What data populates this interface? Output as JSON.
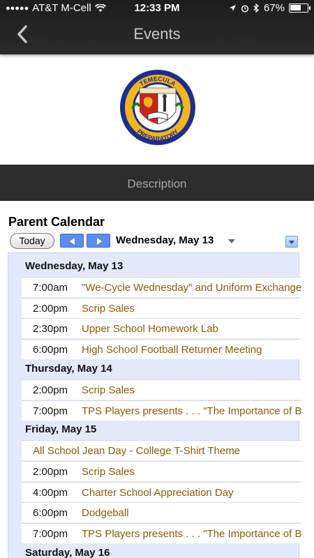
{
  "status_bar": {
    "carrier": "AT&T M-Cell",
    "time": "12:33 PM",
    "battery": "67%",
    "battery_level": 0.67
  },
  "header": {
    "title": "Events",
    "back_icon": "chevron-left-icon"
  },
  "logo": {
    "top_text": "TEMECULA",
    "bottom_text": "PREPARATORY",
    "motto": "DOCERE DISCIPLINA VIRTUS"
  },
  "description_bar": {
    "label": "Description"
  },
  "calendar": {
    "title": "Parent Calendar",
    "today_label": "Today",
    "current_date": "Wednesday, May 13",
    "days": [
      {
        "label": "Wednesday, May 13",
        "events": [
          {
            "time": "7:00am",
            "title": "\"We-Cycle Wednesday\" and Uniform Exchange"
          },
          {
            "time": "2:00pm",
            "title": "Scrip Sales"
          },
          {
            "time": "2:30pm",
            "title": "Upper School Homework Lab"
          },
          {
            "time": "6:00pm",
            "title": "High School Football Returner Meeting"
          }
        ]
      },
      {
        "label": "Thursday, May 14",
        "events": [
          {
            "time": "2:00pm",
            "title": "Scrip Sales"
          },
          {
            "time": "7:00pm",
            "title": "TPS Players presents . . . \"The Importance of Being Earnest\""
          }
        ]
      },
      {
        "label": "Friday, May 15",
        "events": [
          {
            "time": "",
            "title": "All School Jean Day - College T-Shirt Theme"
          },
          {
            "time": "2:00pm",
            "title": "Scrip Sales"
          },
          {
            "time": "4:00pm",
            "title": "Charter School Appreciation Day"
          },
          {
            "time": "6:00pm",
            "title": "Dodgeball"
          },
          {
            "time": "7:00pm",
            "title": "TPS Players presents . . . \"The Importance of Being Earnest\""
          }
        ]
      },
      {
        "label": "Saturday, May 16",
        "events": []
      }
    ]
  }
}
